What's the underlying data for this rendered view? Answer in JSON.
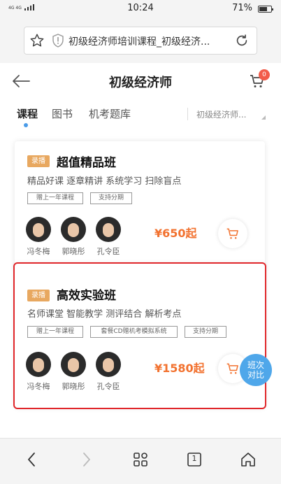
{
  "status_bar": {
    "network_label": "4G 4G",
    "time": "10:24",
    "battery_pct": "71%",
    "battery_level": 0.71
  },
  "browser": {
    "url_title": "初级经济师培训课程_初级经济...",
    "icons": [
      "star-icon",
      "shield-warning-icon",
      "reload-icon"
    ]
  },
  "header": {
    "title": "初级经济师",
    "cart_count": "0"
  },
  "tabs": {
    "items": [
      "课程",
      "图书",
      "机考题库"
    ],
    "active": "课程",
    "category": "初级经济师..."
  },
  "cards": [
    {
      "badge": "录播",
      "name": "超值精品班",
      "desc": "精品好课 逐章精讲 系统学习 扫除盲点",
      "tags": [
        "赠上一年课程",
        "支持分期"
      ],
      "teachers": [
        "冯冬梅",
        "郭晓彤",
        "孔令臣"
      ],
      "price": "¥650起"
    },
    {
      "badge": "录播",
      "name": "高效实验班",
      "desc": "名师课堂 智能教学 测评结合 解析考点",
      "tags": [
        "赠上一年课程",
        "套餐CD赠机考模拟系统",
        "支持分期"
      ],
      "teachers": [
        "冯冬梅",
        "郭晓彤",
        "孔令臣"
      ],
      "price": "¥1580起"
    }
  ],
  "compare_button": {
    "line1": "班次",
    "line2": "对比"
  },
  "bottom_nav": {
    "icons": [
      "back-icon",
      "forward-icon",
      "apps-icon",
      "tabs-icon",
      "home-icon"
    ],
    "tabs_count": "1"
  },
  "colors": {
    "accent": "#f2712e",
    "badge": "#e8a860",
    "compare": "#4fa7ea",
    "highlight": "#e0262a",
    "cart_badge": "#f25c4a"
  }
}
